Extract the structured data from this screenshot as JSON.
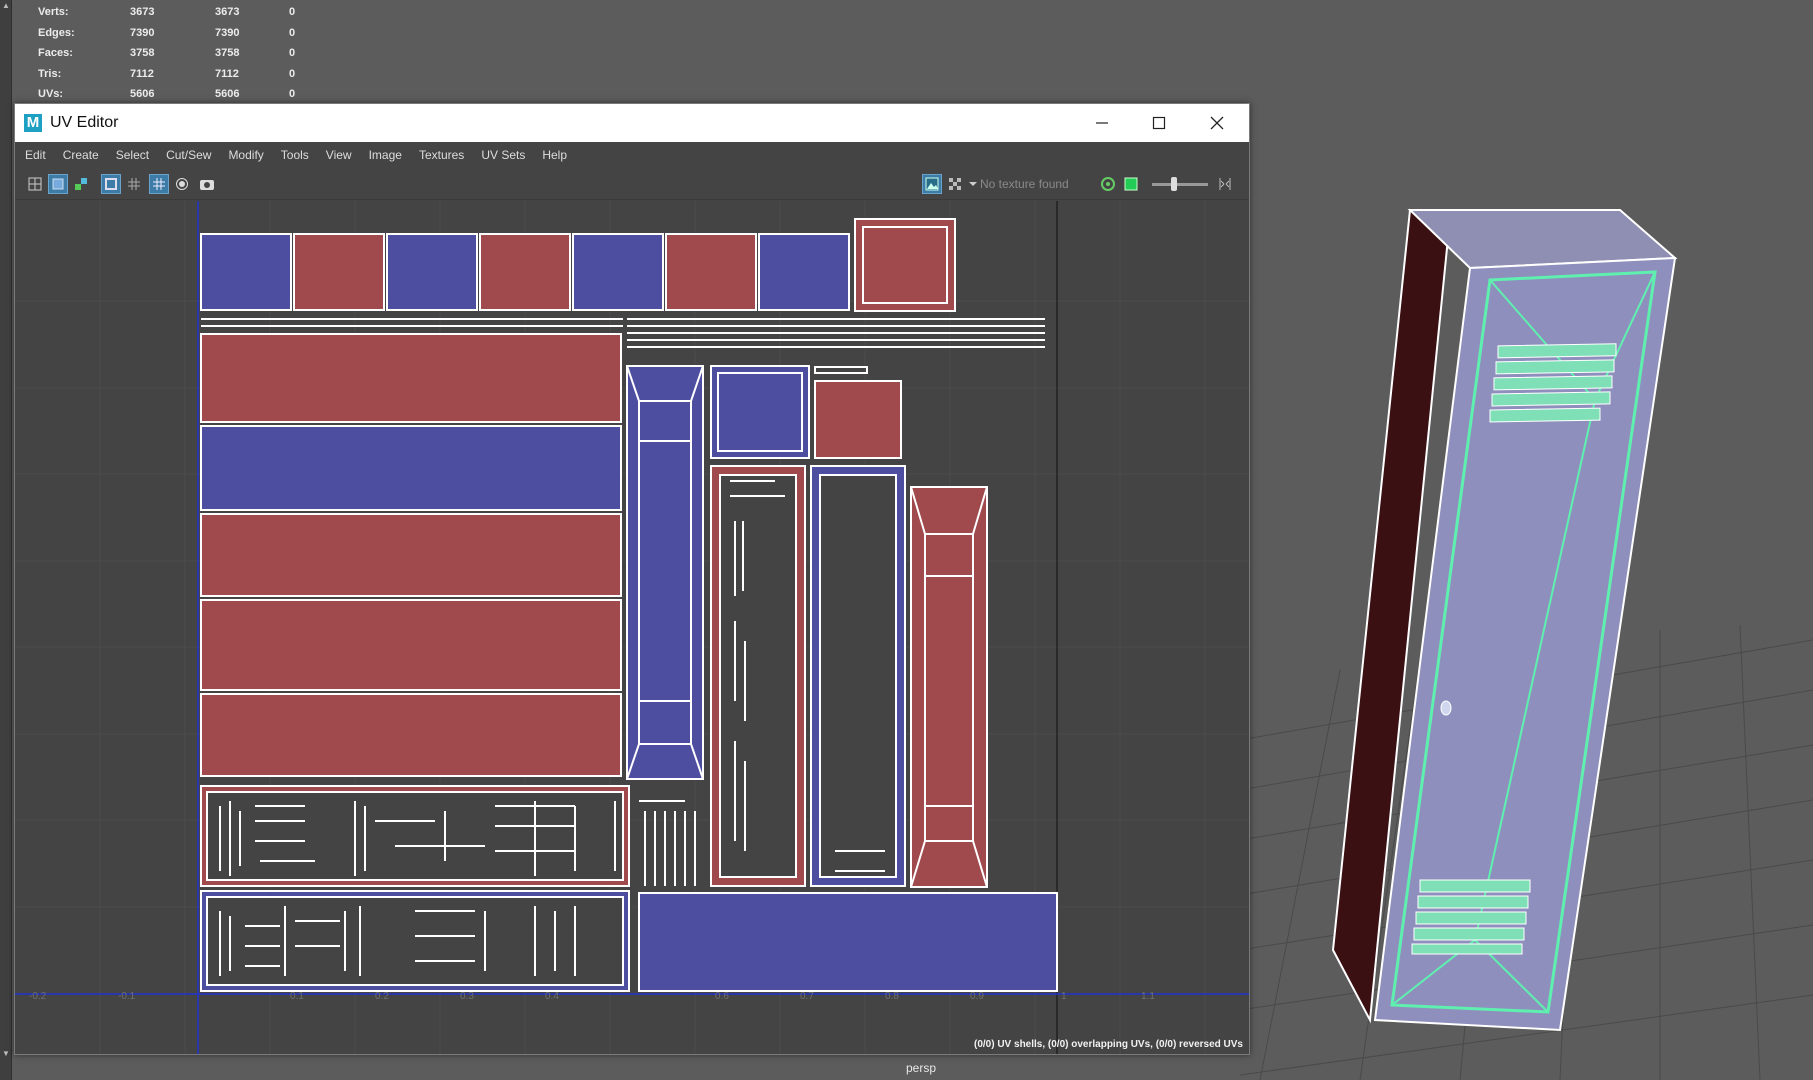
{
  "hud": {
    "rows": [
      {
        "label": "Verts:",
        "v1": "3673",
        "v2": "3673",
        "v3": "0"
      },
      {
        "label": "Edges:",
        "v1": "7390",
        "v2": "7390",
        "v3": "0"
      },
      {
        "label": "Faces:",
        "v1": "3758",
        "v2": "3758",
        "v3": "0"
      },
      {
        "label": "Tris:",
        "v1": "7112",
        "v2": "7112",
        "v3": "0"
      },
      {
        "label": "UVs:",
        "v1": "5606",
        "v2": "5606",
        "v3": "0"
      }
    ]
  },
  "viewport": {
    "camera_label": "persp"
  },
  "uv_editor": {
    "title": "UV Editor",
    "menus": [
      "Edit",
      "Create",
      "Select",
      "Cut/Sew",
      "Modify",
      "Tools",
      "View",
      "Image",
      "Textures",
      "UV Sets",
      "Help"
    ],
    "texture_status": "No texture found",
    "status_text": "(0/0) UV shells, (0/0) overlapping UVs, (0/0) reversed UVs",
    "ruler_labels": [
      "-0.2",
      "-0.1",
      "0.1",
      "0.2",
      "0.3",
      "0.4",
      "0.6",
      "0.7",
      "0.8",
      "0.9",
      "1",
      "1.1"
    ],
    "colors": {
      "red_shell": "#a04a4e",
      "blue_shell": "#4e4ea0",
      "uv_edge": "#ffffff",
      "axis": "#2233cc"
    }
  }
}
